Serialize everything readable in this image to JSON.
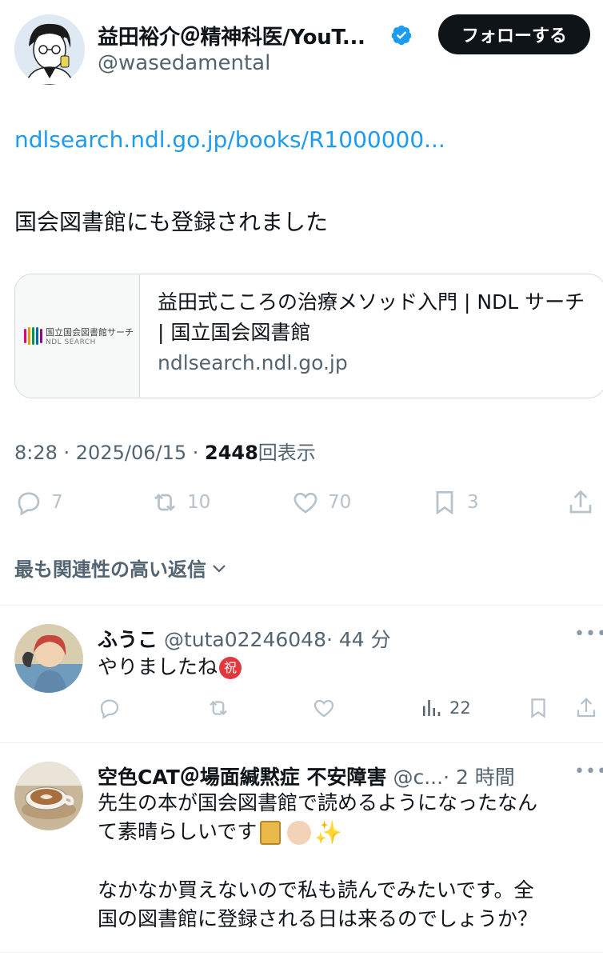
{
  "author": {
    "name": "益田裕介＠精神科医/YouT...",
    "handle": "@wasedamental",
    "follow_label": "フォローする"
  },
  "tweet": {
    "link_text": "ndlsearch.ndl.go.jp/books/R1000000...",
    "text": "国会図書館にも登録されました",
    "card": {
      "title": "益田式こころの治療メソッド入門 | NDL サーチ | 国立国会図書館",
      "domain": "ndlsearch.ndl.go.jp",
      "thumb_line1": "国立国会図書館サーチ",
      "thumb_line2": "NDL SEARCH"
    },
    "time": "8:28 · 2025/06/15 · ",
    "views_count": "2448",
    "views_label": "回表示",
    "stats": {
      "replies": "7",
      "retweets": "10",
      "likes": "70",
      "bookmarks": "3"
    }
  },
  "replies_sort_label": "最も関連性の高い返信",
  "replies": [
    {
      "name": "ふうこ",
      "handle": "@tuta02246048",
      "time": "· 44 分",
      "text": "やりましたね",
      "badge": "祝",
      "views": "22"
    },
    {
      "name": "空色CAT＠場面緘黙症 不安障害",
      "handle": "@c...",
      "time": "· 2 時間",
      "text_line1": "先生の本が国会図書館で読めるようになったなん",
      "text_line2": "て素晴らしいです",
      "text_line3": "なかなか買えないので私も読んでみたいです。全",
      "text_line4": "国の図書館に登録される日は来るのでしょうか？"
    }
  ],
  "colors": {
    "link": "#1d9bf0",
    "verified": "#1d9bf0",
    "secondary_text": "#536471",
    "button_bg": "#0f1419"
  }
}
